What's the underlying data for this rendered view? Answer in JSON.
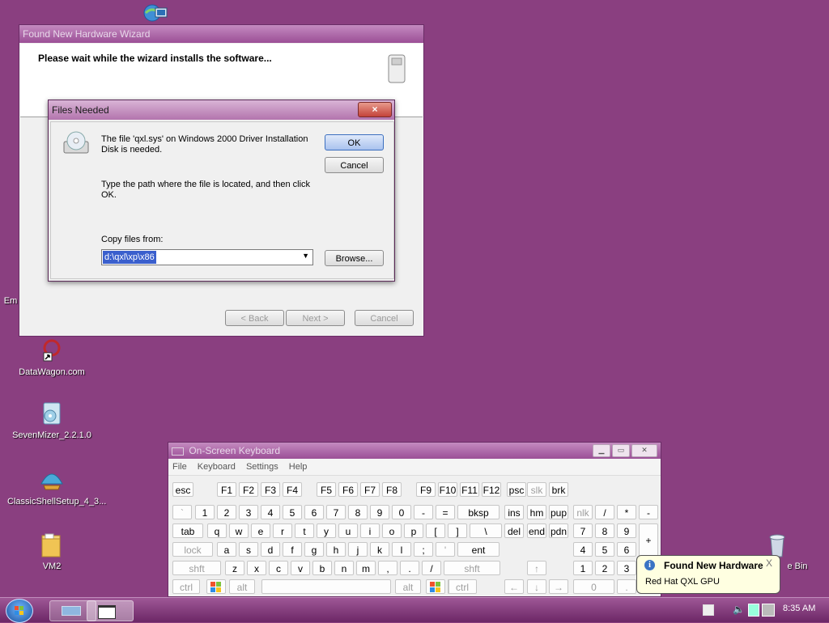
{
  "desktop": {
    "icons": [
      {
        "label": "Em"
      },
      {
        "label": "DataWagon.com"
      },
      {
        "label": "SevenMizer_2.2.1.0"
      },
      {
        "label": "ClassicShellSetup_4_3..."
      },
      {
        "label": "VM2"
      },
      {
        "label": "e Bin"
      }
    ]
  },
  "wizard": {
    "title": "Found New Hardware Wizard",
    "heading": "Please wait while the wizard installs the software...",
    "buttons": {
      "back": "< Back",
      "next": "Next >",
      "cancel": "Cancel"
    }
  },
  "files_dialog": {
    "title": "Files Needed",
    "close": "×",
    "message1": "The file 'qxl.sys' on Windows 2000 Driver Installation Disk is needed.",
    "message2": "Type the path where the file is located, and then click OK.",
    "copy_label": "Copy files from:",
    "path_value": "d:\\qxl\\xp\\x86",
    "ok": "OK",
    "cancel": "Cancel",
    "browse": "Browse..."
  },
  "osk": {
    "title": "On-Screen Keyboard",
    "menu": [
      "File",
      "Keyboard",
      "Settings",
      "Help"
    ],
    "rows": {
      "fn": [
        "esc",
        "F1",
        "F2",
        "F3",
        "F4",
        "F5",
        "F6",
        "F7",
        "F8",
        "F9",
        "F10",
        "F11",
        "F12",
        "psc",
        "slk",
        "brk"
      ],
      "num": [
        "`",
        "1",
        "2",
        "3",
        "4",
        "5",
        "6",
        "7",
        "8",
        "9",
        "0",
        "-",
        "=",
        "bksp",
        "ins",
        "hm",
        "pup",
        "nlk",
        "/",
        "*",
        "-"
      ],
      "top": [
        "tab",
        "q",
        "w",
        "e",
        "r",
        "t",
        "y",
        "u",
        "i",
        "o",
        "p",
        "[",
        "]",
        "\\",
        "del",
        "end",
        "pdn",
        "7",
        "8",
        "9",
        "+"
      ],
      "mid": [
        "lock",
        "a",
        "s",
        "d",
        "f",
        "g",
        "h",
        "j",
        "k",
        "l",
        ";",
        "'",
        "ent",
        "4",
        "5",
        "6"
      ],
      "bot": [
        "shft",
        "z",
        "x",
        "c",
        "v",
        "b",
        "n",
        "m",
        ",",
        ".",
        "/",
        "shft",
        "↑",
        "1",
        "2",
        "3"
      ],
      "sp": [
        "ctrl",
        "alt",
        "alt",
        "ctrl",
        "←",
        "↓",
        "→",
        "0",
        "."
      ]
    }
  },
  "balloon": {
    "title": "Found New Hardware",
    "body": "Red Hat QXL GPU",
    "close": "X"
  },
  "taskbar": {
    "clock": "8:35 AM"
  },
  "colors": {
    "desktop": "#8a3f80",
    "titlebar": "#9b4f96",
    "selection": "#3a5fcd"
  }
}
